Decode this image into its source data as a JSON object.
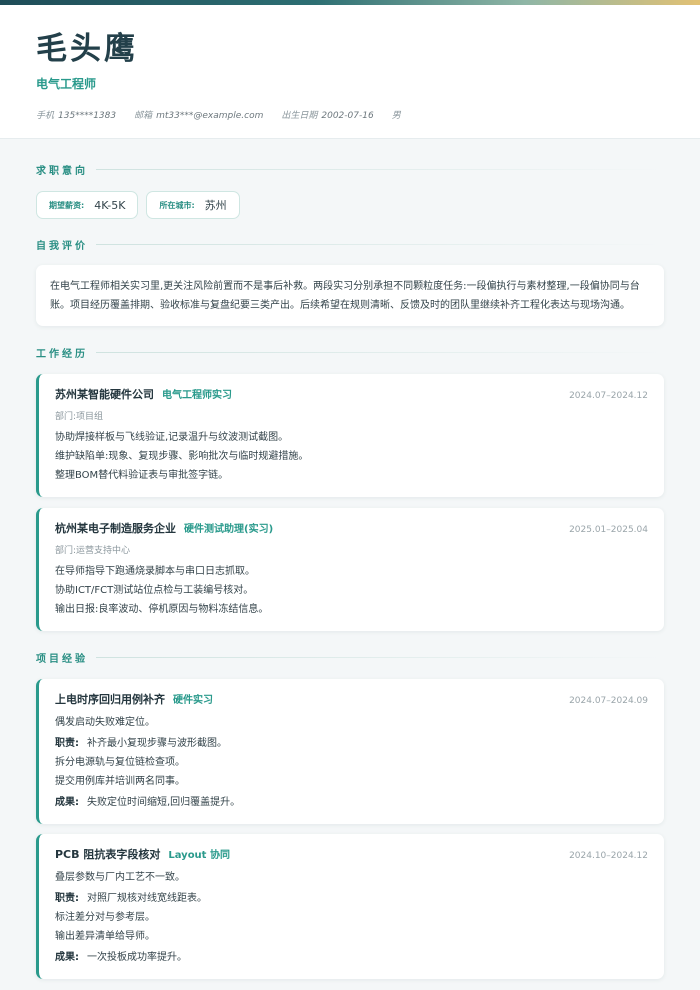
{
  "header": {
    "name": "毛头鹰",
    "role": "电气工程师",
    "phone_label": "手机",
    "phone": "135****1383",
    "email_label": "邮箱",
    "email": "mt33***@example.com",
    "birth_label": "出生日期",
    "birth": "2002-07-16",
    "gender": "男"
  },
  "sections": {
    "intent": "求职意向",
    "self_eval": "自我评价",
    "work": "工作经历",
    "projects": "项目经验"
  },
  "intent": {
    "salary_label": "期望薪资:",
    "salary": "4K-5K",
    "city_label": "所在城市:",
    "city": "苏州"
  },
  "summary": "在电气工程师相关实习里,更关注风险前置而不是事后补救。两段实习分别承担不同颗粒度任务:一段偏执行与素材整理,一段偏协同与台账。项目经历覆盖排期、验收标准与复盘纪要三类产出。后续希望在规则清晰、反馈及时的团队里继续补齐工程化表达与现场沟通。",
  "work": [
    {
      "company": "苏州某智能硬件公司",
      "title": "电气工程师实习",
      "date": "2024.07–2024.12",
      "dept": "部门:项目组",
      "bullets": [
        "协助焊接样板与飞线验证,记录温升与纹波测试截图。",
        "维护缺陷单:现象、复现步骤、影响批次与临时规避措施。",
        "整理BOM替代料验证表与审批签字链。"
      ]
    },
    {
      "company": "杭州某电子制造服务企业",
      "title": "硬件测试助理(实习)",
      "date": "2025.01–2025.04",
      "dept": "部门:运营支持中心",
      "bullets": [
        "在导师指导下跑通烧录脚本与串口日志抓取。",
        "协助ICT/FCT测试站位点检与工装编号核对。",
        "输出日报:良率波动、停机原因与物料冻结信息。"
      ]
    }
  ],
  "projects": [
    {
      "name": "上电时序回归用例补齐",
      "tag": "硬件实习",
      "date": "2024.07–2024.09",
      "desc": "偶发启动失败难定位。",
      "duty_label": "职责:",
      "duties": [
        "补齐最小复现步骤与波形截图。",
        "拆分电源轨与复位链检查项。",
        "提交用例库并培训两名同事。"
      ],
      "result_label": "成果:",
      "result": "失败定位时间缩短,回归覆盖提升。"
    },
    {
      "name": "PCB 阻抗表字段核对",
      "tag": "Layout 协同",
      "date": "2024.10–2024.12",
      "desc": "叠层参数与厂内工艺不一致。",
      "duty_label": "职责:",
      "duties": [
        "对照厂规核对线宽线距表。",
        "标注差分对与参考层。",
        "输出差异清单给导师。"
      ],
      "result_label": "成果:",
      "result": "一次投板成功率提升。"
    }
  ],
  "colors": {
    "accent": "#2a9a8c",
    "title": "#23404a",
    "background": "#f4f7f8"
  }
}
